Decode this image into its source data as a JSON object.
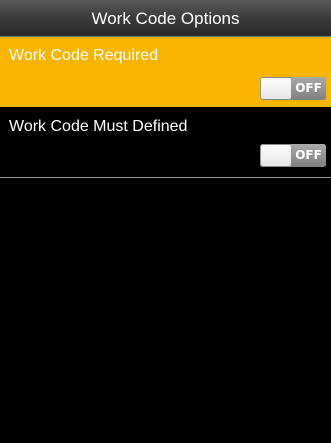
{
  "header": {
    "title": "Work Code Options"
  },
  "options": [
    {
      "label": "Work Code Required",
      "toggle_state": "OFF",
      "selected": true
    },
    {
      "label": "Work Code Must Defined",
      "toggle_state": "OFF",
      "selected": false
    }
  ],
  "colors": {
    "selected_row": "#f7b500",
    "background": "#000000",
    "title_bar": "#3d3d3d",
    "toggle_off_fill": "#808080"
  }
}
